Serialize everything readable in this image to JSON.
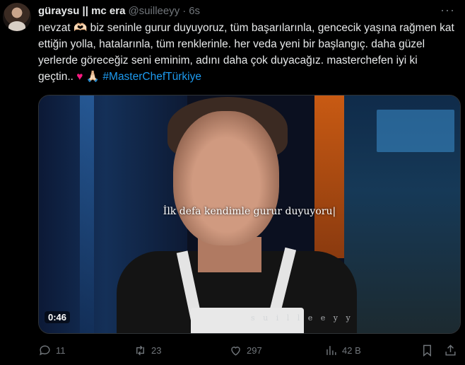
{
  "tweet": {
    "display_name": "güraysu || mc era",
    "handle": "@suilleeyy",
    "separator": "·",
    "time": "6s",
    "text_main": "nevzat 🫶🏻 biz seninle gurur duyuyoruz, tüm başarılarınla, gencecik yaşına rağmen kat ettiğin yolla, hatalarınla, tüm renklerinle. her veda yeni bir başlangıç. daha güzel yerlerde göreceğiz seni eminim, adını daha çok duyacağız. masterchefen iyi ki geçtin..",
    "text_emoji": " ♥ 🙏🏻 ",
    "hashtag": "#MasterChefTürkiye"
  },
  "media": {
    "subtitle": "İlk defa kendimle gurur duyuyoru|",
    "watermark": "s u i l l e e y y",
    "timecode": "0:46"
  },
  "actions": {
    "replies": "11",
    "reposts": "23",
    "likes": "297",
    "views": "42 B"
  },
  "icons": {
    "more": "more-icon",
    "reply": "reply-icon",
    "repost": "repost-icon",
    "like": "heart-icon",
    "views": "views-icon",
    "bookmark": "bookmark-icon",
    "share": "share-icon"
  },
  "colors": {
    "background": "#000000",
    "text": "#e7e9ea",
    "muted": "#71767b",
    "accent": "#1d9bf0",
    "heart": "#f91880"
  }
}
